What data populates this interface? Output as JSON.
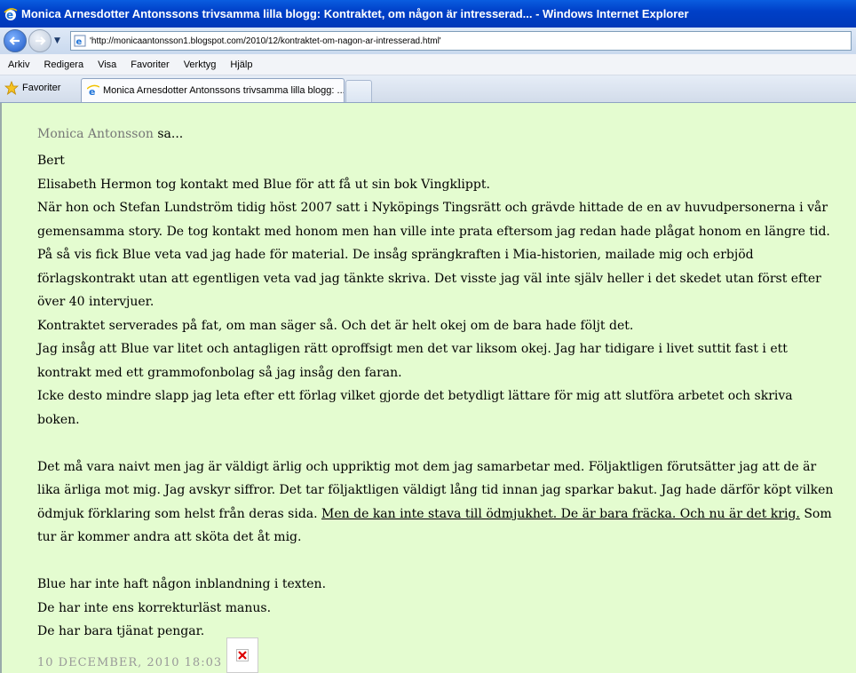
{
  "window": {
    "title": "Monica Arnesdotter Antonssons trivsamma lilla blogg: Kontraktet, om någon är intresserad... - Windows Internet Explorer"
  },
  "address": {
    "url": "'http://monicaantonsson1.blogspot.com/2010/12/kontraktet-om-nagon-ar-intresserad.html'"
  },
  "menu": [
    "Arkiv",
    "Redigera",
    "Visa",
    "Favoriter",
    "Verktyg",
    "Hjälp"
  ],
  "favorites": {
    "label": "Favoriter"
  },
  "tab": {
    "label": "Monica Arnesdotter Antonssons trivsamma lilla blogg: ..."
  },
  "comment": {
    "author": "Monica Antonsson",
    "says": " sa...",
    "paragraphs": [
      "Bert",
      "Elisabeth Hermon tog kontakt med Blue för att få ut sin bok Vingklippt.",
      "När hon och Stefan Lundström tidig höst 2007 satt i Nyköpings Tingsrätt och grävde hittade de en av huvudpersonerna i vår gemensamma story. De tog kontakt med honom men han ville inte prata eftersom jag redan hade plågat honom en längre tid.",
      "På så vis fick Blue veta vad jag hade för material. De insåg sprängkraften i Mia-historien, mailade mig och erbjöd förlagskontrakt utan att egentligen veta vad jag tänkte skriva. Det visste jag väl inte själv heller i det skedet utan först efter över 40 intervjuer.",
      "Kontraktet serverades på fat, om man säger så. Och det är helt okej om de bara hade följt det.",
      "Jag insåg att Blue var litet och antagligen rätt oproffsigt men det var liksom okej. Jag har tidigare i livet suttit fast i ett kontrakt med ett grammofonbolag så jag insåg den faran.",
      "Icke desto mindre slapp jag leta efter ett förlag vilket gjorde det betydligt lättare för mig att slutföra arbetet och skriva boken."
    ],
    "para2_before": "Det må vara naivt men jag är väldigt ärlig och uppriktig mot dem jag samarbetar med. Följaktligen förutsätter jag att de är lika ärliga mot mig. Jag avskyr siffror. Det tar följaktligen väldigt lång tid innan jag sparkar bakut. Jag hade därför köpt vilken ödmjuk förklaring som helst från deras sida. ",
    "para2_link": "Men de kan inte stava till ödmjukhet. De är bara fräcka. Och nu är det krig.",
    "para2_after": " Som tur är kommer andra att sköta det åt mig.",
    "closing": [
      "Blue har inte haft någon inblandning i texten.",
      "De har inte ens korrekturläst manus.",
      "De har bara tjänat pengar."
    ],
    "timestamp": "10 DECEMBER, 2010 18:03"
  },
  "colors": {
    "content_bg": "#e4fcd0",
    "titlebar": "#0040c8",
    "author": "#777777",
    "timestamp": "#999999"
  }
}
